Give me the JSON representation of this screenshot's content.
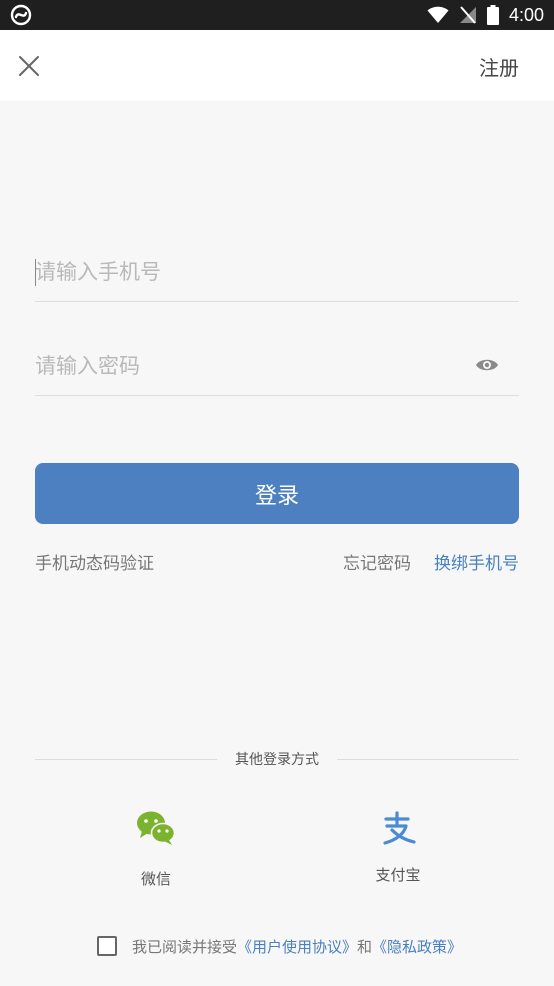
{
  "status_bar": {
    "time": "4:00",
    "icons": [
      "app-notification-icon",
      "wifi-icon",
      "no-signal-icon",
      "battery-icon"
    ]
  },
  "header": {
    "close_icon": "close-icon",
    "register_label": "注册"
  },
  "form": {
    "phone": {
      "placeholder": "请输入手机号",
      "value": ""
    },
    "password": {
      "placeholder": "请输入密码",
      "value": "",
      "toggle_icon": "eye-icon"
    },
    "login_label": "登录"
  },
  "links": {
    "otp_label": "手机动态码验证",
    "forgot_label": "忘记密码",
    "rebind_label": "换绑手机号"
  },
  "other_login": {
    "title": "其他登录方式",
    "wechat": {
      "label": "微信",
      "icon": "wechat-icon",
      "color": "#7bb32e"
    },
    "alipay": {
      "label": "支付宝",
      "icon": "alipay-icon",
      "color": "#4a8bd3"
    }
  },
  "agreement": {
    "checked": false,
    "prefix": "我已阅读并接受",
    "user_agreement": "《用户使用协议》",
    "conjunction": "和",
    "privacy_policy": "《隐私政策》"
  },
  "colors": {
    "primary": "#4c80c1",
    "link": "#4a7fc0",
    "background": "#f7f7f7",
    "status_bar": "#1f1f1f"
  }
}
